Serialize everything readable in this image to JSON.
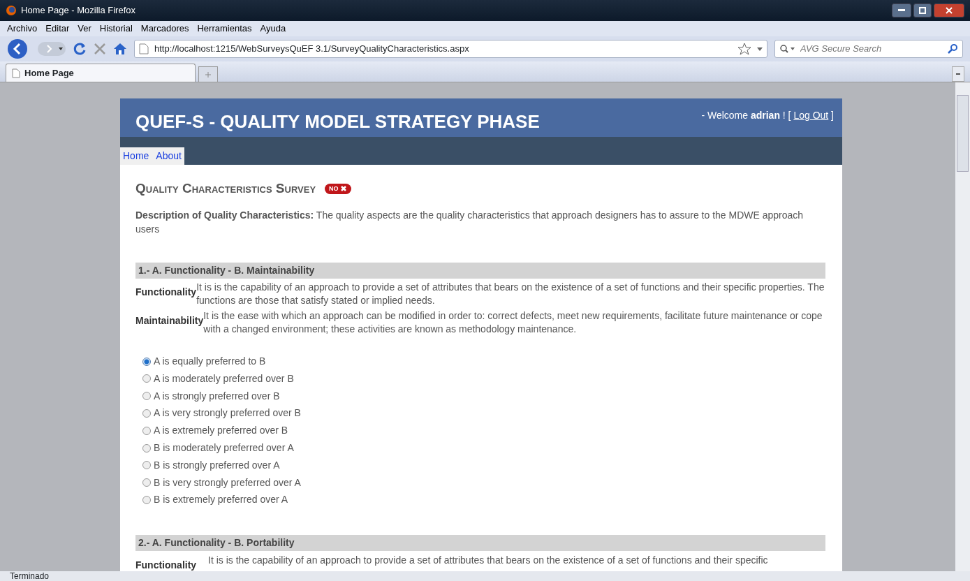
{
  "window": {
    "title": "Home Page - Mozilla Firefox"
  },
  "menu": [
    "Archivo",
    "Editar",
    "Ver",
    "Historial",
    "Marcadores",
    "Herramientas",
    "Ayuda"
  ],
  "address": {
    "value": "http://localhost:1215/WebSurveysQuEF 3.1/SurveyQualityCharacteristics.aspx"
  },
  "search": {
    "placeholder": "AVG Secure Search"
  },
  "tabs": [
    {
      "label": "Home Page",
      "selected": true
    }
  ],
  "page": {
    "title": "QUEF-S - QUALITY MODEL STRATEGY PHASE",
    "login": {
      "prefix": "- Welcome",
      "user": "adrian",
      "suffix": "! [",
      "link": "Log Out",
      "close": "]"
    },
    "nav": [
      {
        "label": "Home",
        "selected": false
      },
      {
        "label": "About",
        "selected": false
      }
    ],
    "survey_title": "Quality Characteristics Survey",
    "toggle": {
      "label": "NO",
      "on": false
    },
    "description": "**Description of Quality Characteristics:** The quality aspects are the quality characteristics that approach designers has to assure to the MDWE approach users",
    "sections": [
      {
        "heading": "1.- A. Functionality - B. Maintainability",
        "terms": [
          {
            "term": "Functionality",
            "definition": "It is is the capability of an approach to provide a set of attributes that bears on the existence of a set of functions and their specific properties. The functions are those that satisfy stated or implied needs."
          },
          {
            "term": "Maintainability",
            "definition": "It is the ease with which an approach can be modified in order to: correct defects, meet new requirements, facilitate future maintenance or cope with a changed environment; these activities are known as methodology maintenance."
          }
        ],
        "options": [
          {
            "label": "A is equally preferred to B",
            "selected": true
          },
          {
            "label": "A is moderately preferred over B",
            "selected": false
          },
          {
            "label": "A is strongly preferred over B",
            "selected": false
          },
          {
            "label": "A is very strongly preferred over B",
            "selected": false
          },
          {
            "label": "A is extremely preferred over B",
            "selected": false
          },
          {
            "label": "B is moderately preferred over A",
            "selected": false
          },
          {
            "label": "B is strongly preferred over A",
            "selected": false
          },
          {
            "label": "B is very strongly preferred over A",
            "selected": false
          },
          {
            "label": "B is extremely preferred over A",
            "selected": false
          }
        ]
      },
      {
        "heading": "2.- A. Functionality - B. Portability",
        "terms": [
          {
            "term": "Functionality",
            "definition": "It is is the capability of an approach to provide a set of attributes that bears on the existence of a set of functions and their specific"
          }
        ]
      }
    ]
  },
  "status_bar": "Terminado"
}
